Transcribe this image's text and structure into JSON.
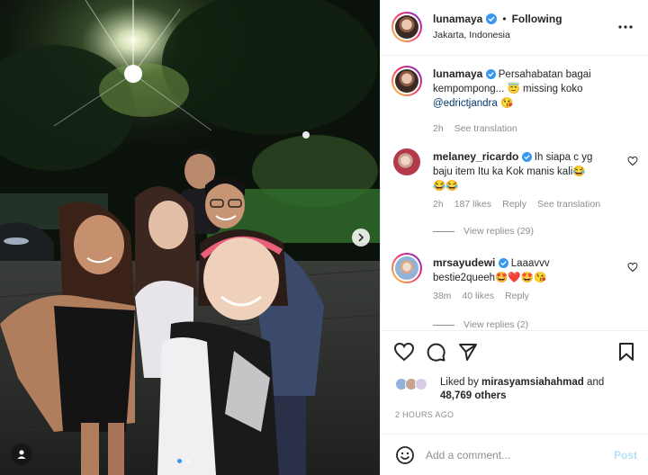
{
  "post": {
    "author": "lunamaya",
    "follow_status": "Following",
    "separator": "•",
    "location": "Jakarta, Indonesia",
    "more_icon": "more-horizontal-icon"
  },
  "caption": {
    "author": "lunamaya",
    "text_line1": "Persahabatan bagai",
    "text_line2": "kempompong...",
    "emoji1": "😇",
    "text_tail": "missing koko",
    "mention": "@edrictjandra",
    "emoji2": "😘",
    "time": "2h",
    "see_translation": "See translation"
  },
  "comments": [
    {
      "author": "melaney_ricardo",
      "text_line1": "Ih siapa c yg",
      "text_line2": "baju item Itu ka Kok manis kali",
      "emoji_end": "😂",
      "emoji_line3": "😂😂",
      "time": "2h",
      "likes": "187 likes",
      "reply": "Reply",
      "see_translation": "See translation",
      "view_replies": "View replies (29)"
    },
    {
      "author": "mrsayudewi",
      "text_line1": "Laaavvv",
      "text_line2": "bestie2queeh",
      "emojis": "🤩❤️🤩😘",
      "time": "38m",
      "likes": "40 likes",
      "reply": "Reply",
      "view_replies": "View replies (2)"
    }
  ],
  "likes": {
    "prefix": "Liked by",
    "user": "mirasyamsiahahmad",
    "and": "and",
    "count": "48,769 others"
  },
  "timestamp": "2 HOURS AGO",
  "comment_box": {
    "placeholder": "Add a comment...",
    "post_label": "Post",
    "emoji_icon": "smiley-icon"
  },
  "carousel": {
    "slide_count": 2,
    "active_index": 0
  },
  "colors": {
    "verified": "#3897f0",
    "link": "#00376b",
    "post_disabled": "#b2dffc",
    "heart_red": "#ed4956"
  }
}
